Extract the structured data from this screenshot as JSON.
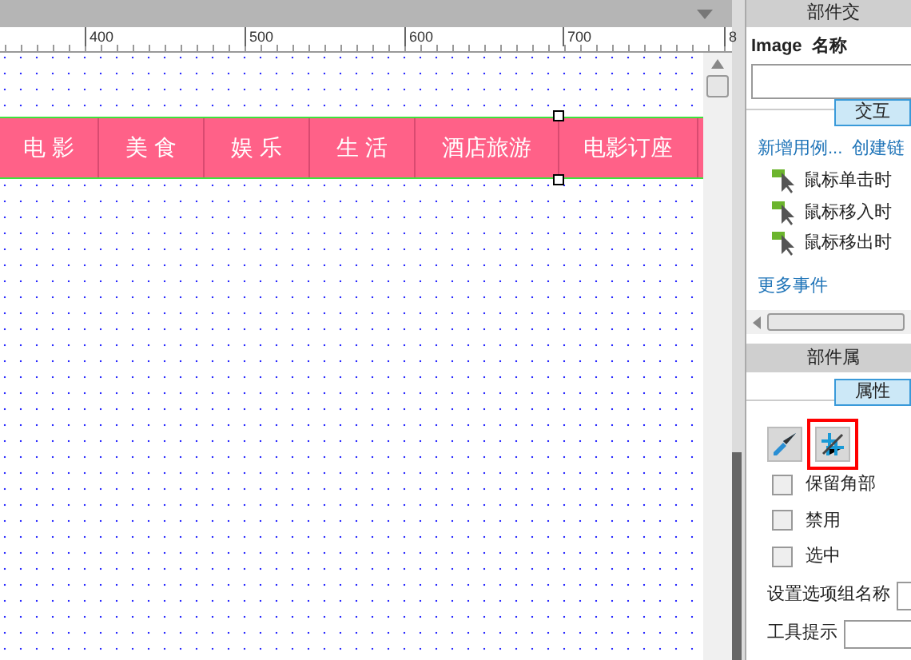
{
  "ruler": {
    "labels": [
      "400",
      "500",
      "600",
      "700",
      "8"
    ]
  },
  "nav": {
    "items": [
      {
        "label": "电 影",
        "selected": false
      },
      {
        "label": "美 食",
        "selected": false
      },
      {
        "label": "娱 乐",
        "selected": false
      },
      {
        "label": "生 活",
        "selected": false
      },
      {
        "label": "酒店旅游",
        "selected": false
      },
      {
        "label": "电影订座",
        "selected": true
      }
    ]
  },
  "interactions": {
    "title": "部件交",
    "name_label": "Image  名称",
    "tab": "交互",
    "links": [
      "新增用例...",
      "创建链"
    ],
    "events": [
      {
        "label": "鼠标单击时"
      },
      {
        "label": "鼠标移入时"
      },
      {
        "label": "鼠标移出时"
      }
    ],
    "more": "更多事件"
  },
  "properties": {
    "title": "部件属",
    "tab": "属性",
    "tools": [
      {
        "kind": "brush",
        "selected": false
      },
      {
        "kind": "crop",
        "selected": true
      }
    ],
    "checks": [
      {
        "label": "保留角部",
        "checked": false
      },
      {
        "label": "禁用",
        "checked": false
      },
      {
        "label": "选中",
        "checked": false
      }
    ],
    "group_label": "设置选项组名称",
    "tooltip_label": "工具提示"
  }
}
